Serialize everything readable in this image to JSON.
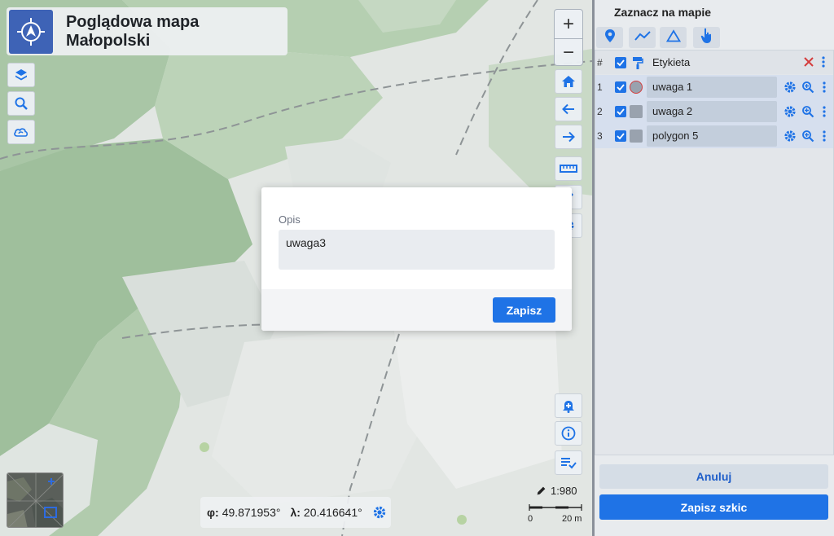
{
  "app": {
    "title": "Poglądowa mapa Małopolski"
  },
  "map": {
    "coords": {
      "lat_label": "φ:",
      "lat_value": "49.871953°",
      "lon_label": "λ:",
      "lon_value": "20.416641°"
    },
    "scale_text": "1:980",
    "scale_left": "0",
    "scale_right": "20 m",
    "zoom_in": "+",
    "zoom_out": "−"
  },
  "modal": {
    "label": "Opis",
    "value": "uwaga3",
    "save_label": "Zapisz"
  },
  "panel": {
    "title": "Zaznacz na mapie",
    "header": {
      "num": "#",
      "label_col": "Etykieta"
    },
    "rows": [
      {
        "num": "1",
        "name": "uwaga 1",
        "shape": "circle"
      },
      {
        "num": "2",
        "name": "uwaga 2",
        "shape": "square"
      },
      {
        "num": "3",
        "name": "polygon 5",
        "shape": "square"
      }
    ],
    "cancel_label": "Anuluj",
    "save_sketch_label": "Zapisz szkic"
  },
  "colors": {
    "accent": "#1f73e6",
    "delete": "#d43d3d"
  }
}
